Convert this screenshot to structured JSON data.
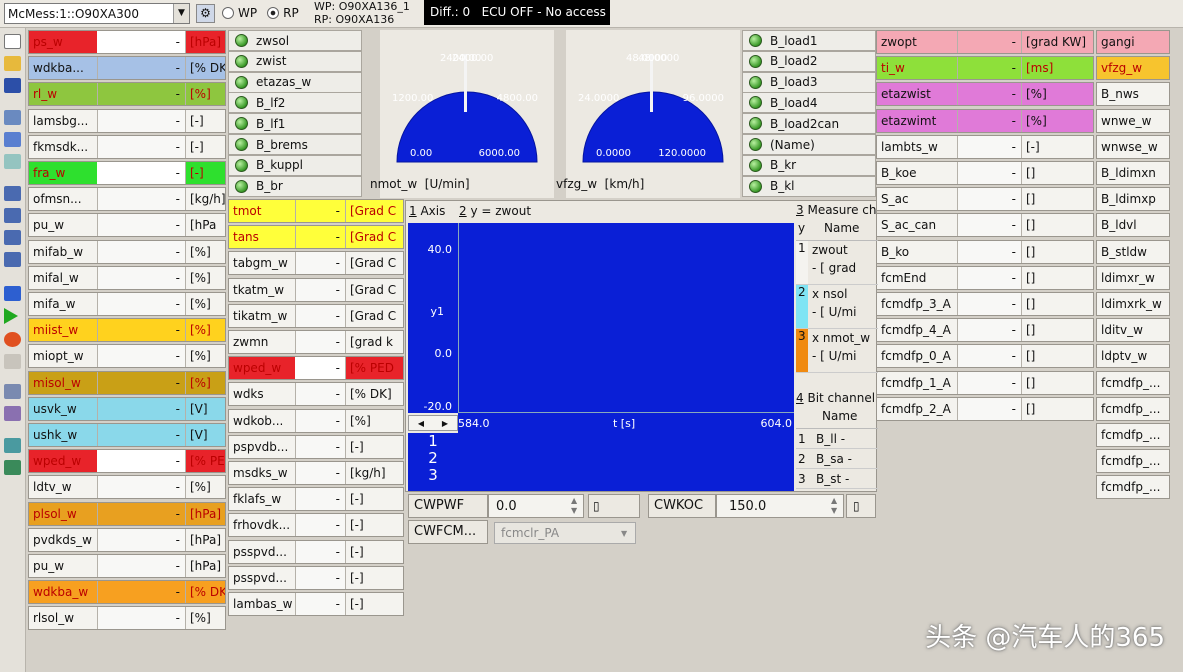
{
  "top": {
    "device": "McMess:1::O90XA300",
    "wp": "WP",
    "rp": "RP",
    "wp_val": "WP: O90XA136_1",
    "rp_val": "RP: O90XA136",
    "status": "Diff.: 0   ECU OFF - No access"
  },
  "col1": [
    {
      "n": "ps_w",
      "u": "[hPa]",
      "c": "#e8232a",
      "t": "#b00",
      "bar": 1
    },
    {
      "n": "wdkba...",
      "u": "[% DK]",
      "c": "#a6c1e6"
    },
    {
      "n": "rl_w",
      "u": "[%]",
      "c": "#8ec63f",
      "t": "#b00"
    },
    {
      "n": "lamsbg...",
      "u": "[-]"
    },
    {
      "n": "fkmsdk...",
      "u": "[-]"
    },
    {
      "n": "fra_w",
      "u": "[-]",
      "c": "#2ee02e",
      "t": "#b00",
      "bar": 1
    },
    {
      "n": "ofmsn...",
      "u": "[kg/h]"
    },
    {
      "n": "pu_w",
      "u": "[hPa"
    },
    {
      "n": "mifab_w",
      "u": "[%]"
    },
    {
      "n": "mifal_w",
      "u": "[%]"
    },
    {
      "n": "mifa_w",
      "u": "[%]"
    },
    {
      "n": "miist_w",
      "u": "[%]",
      "c": "#ffd21e",
      "t": "#b00"
    },
    {
      "n": "miopt_w",
      "u": "[%]"
    },
    {
      "n": "misol_w",
      "u": "[%]",
      "c": "#c9a016",
      "t": "#b00"
    },
    {
      "n": "usvk_w",
      "u": "[V]",
      "c": "#8ad8ea"
    },
    {
      "n": "ushk_w",
      "u": "[V]",
      "c": "#8ad8ea"
    },
    {
      "n": "wped_w",
      "u": "[% PED]",
      "c": "#e8232a",
      "t": "#b00",
      "bar": 1
    },
    {
      "n": "ldtv_w",
      "u": "[%]"
    },
    {
      "n": "plsol_w",
      "u": "[hPa]",
      "c": "#e8a020",
      "t": "#b00"
    },
    {
      "n": "pvdkds_w",
      "u": "[hPa]"
    },
    {
      "n": "pu_w",
      "u": "[hPa]"
    },
    {
      "n": "wdkba_w",
      "u": "[% DK]",
      "c": "#f7a020",
      "t": "#b00"
    },
    {
      "n": "rlsol_w",
      "u": "[%]"
    }
  ],
  "leds1": [
    "zwsol",
    "zwist",
    "etazas_w",
    "B_lf2",
    "B_lf1",
    "B_brems",
    "B_kuppl",
    "B_br"
  ],
  "col2": [
    {
      "n": "tmot",
      "u": "[Grad C",
      "c": "#ffff3a",
      "t": "#b00"
    },
    {
      "n": "tans",
      "u": "[Grad C",
      "c": "#ffff3a",
      "t": "#b00"
    },
    {
      "n": "tabgm_w",
      "u": "[Grad C"
    },
    {
      "n": "tkatm_w",
      "u": "[Grad C"
    },
    {
      "n": "tikatm_w",
      "u": "[Grad C"
    },
    {
      "n": "zwmn",
      "u": "[grad k"
    },
    {
      "n": "wped_w",
      "u": "[% PED",
      "c": "#e8232a",
      "t": "#b00",
      "bar": 1
    },
    {
      "n": "wdks",
      "u": "[% DK]"
    },
    {
      "n": "wdkob...",
      "u": "[%]"
    },
    {
      "n": "pspvdb...",
      "u": "[-]"
    },
    {
      "n": "msdks_w",
      "u": "[kg/h]"
    },
    {
      "n": "fklafs_w",
      "u": "[-]"
    },
    {
      "n": "frhovdk...",
      "u": "[-]"
    },
    {
      "n": "psspvd...",
      "u": "[-]"
    },
    {
      "n": "psspvd...",
      "u": "[-]"
    },
    {
      "n": "lambas_w",
      "u": "[-]"
    }
  ],
  "gauges": [
    {
      "label": "nmot_w  [U/min]",
      "top": "2400.00",
      "mid_l": "1200.00",
      "mid_r": "4800.00",
      "bot_l": "0.00",
      "bot_r": "6000.00",
      "needle": "2400.00"
    },
    {
      "label": "vfzg_w  [km/h]",
      "top": "48.0000",
      "mid_l": "24.0000",
      "mid_r": "96.0000",
      "bot_l": "0.0000",
      "bot_r": "120.0000",
      "needle": "48.0000"
    }
  ],
  "leds2": [
    "B_load1",
    "B_load2",
    "B_load3",
    "B_load4",
    "B_load2can",
    "(Name)",
    "B_kr",
    "B_kl"
  ],
  "col3": [
    {
      "n": "zwopt",
      "u": "[grad KW]",
      "c": "#f4a8b4"
    },
    {
      "n": "ti_w",
      "u": "[ms]",
      "c": "#8ee03a",
      "t": "#b00"
    },
    {
      "n": "etazwist",
      "u": "[%]",
      "c": "#e07ad8"
    },
    {
      "n": "etazwimt",
      "u": "[%]",
      "c": "#e07ad8"
    },
    {
      "n": "lambts_w",
      "u": "[-]"
    },
    {
      "n": "B_koe",
      "u": "[]"
    },
    {
      "n": "S_ac",
      "u": "[]"
    },
    {
      "n": "S_ac_can",
      "u": "[]"
    },
    {
      "n": "B_ko",
      "u": "[]"
    },
    {
      "n": "fcmEnd",
      "u": "[]"
    },
    {
      "n": "fcmdfp_3_A",
      "u": "[]"
    },
    {
      "n": "fcmdfp_4_A",
      "u": "[]"
    },
    {
      "n": "fcmdfp_0_A",
      "u": "[]"
    },
    {
      "n": "fcmdfp_1_A",
      "u": "[]"
    },
    {
      "n": "fcmdfp_2_A",
      "u": "[]"
    }
  ],
  "col4": [
    {
      "n": "gangi",
      "c": "#f4a8b4"
    },
    {
      "n": "vfzg_w",
      "c": "#f7c42e",
      "t": "#b00"
    },
    {
      "n": "B_nws"
    },
    {
      "n": "wnwe_w"
    },
    {
      "n": "wnwse_w"
    },
    {
      "n": "B_ldimxn"
    },
    {
      "n": "B_ldimxp"
    },
    {
      "n": "B_ldvl"
    },
    {
      "n": "B_stldw"
    },
    {
      "n": "ldimxr_w"
    },
    {
      "n": "ldimxrk_w"
    },
    {
      "n": "lditv_w"
    },
    {
      "n": "ldptv_w"
    },
    {
      "n": "fcmdfp_..."
    },
    {
      "n": "fcmdfp_..."
    },
    {
      "n": "fcmdfp_..."
    },
    {
      "n": "fcmdfp_..."
    },
    {
      "n": "fcmdfp_..."
    }
  ],
  "graph": {
    "tab_axis": "Axis",
    "tab_axis_num": "1",
    "tab_y_num": "2",
    "tab_y": "y  =  zwout",
    "y_top": "40.0",
    "y_label": "y1",
    "y_mid": "0.0",
    "y_bot": "-20.0",
    "x_left": "584.0",
    "x_mid": "t [s]",
    "x_right": "604.0",
    "rows": [
      "1",
      "2",
      "3"
    ],
    "measure_title": "Measure ch",
    "measure_num": "3",
    "measure_head_y": "y",
    "measure_head_name": "Name",
    "measure": [
      {
        "i": "1",
        "n": "zwout",
        "u": "- [ grad",
        "c": "#f4f3ef"
      },
      {
        "i": "2",
        "n": "x nsol",
        "u": "- [ U/mi",
        "c": "#7fe4f4"
      },
      {
        "i": "3",
        "n": "x nmot_w",
        "u": "- [ U/mi",
        "c": "#f08a10"
      }
    ],
    "bit_title": "Bit channel",
    "bit_num": "4",
    "bit_head": "Name",
    "bits": [
      {
        "i": "1",
        "n": "B_ll  -"
      },
      {
        "i": "2",
        "n": "B_sa  -"
      },
      {
        "i": "3",
        "n": "B_st  -"
      }
    ]
  },
  "bottom": {
    "cwpwf": "CWPWF",
    "cwpwf_val": "0.0",
    "cwkoc": "CWKOC",
    "cwkoc_val": "150.0",
    "cwfcm": "CWFCM...",
    "cwfcm_sel": "fcmclr_PA"
  },
  "watermark": "头条 @汽车人的365"
}
